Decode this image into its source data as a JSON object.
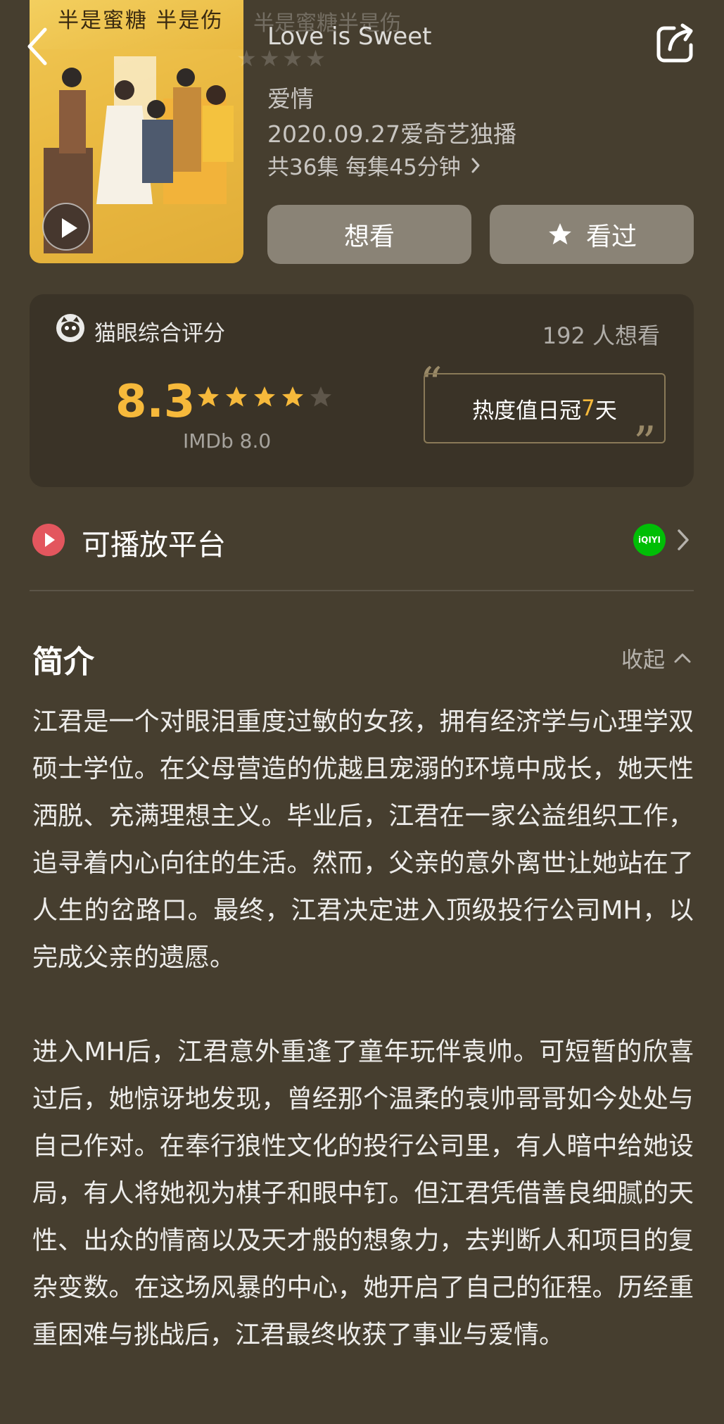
{
  "header": {
    "poster_title": "半是蜜糖 半是伤",
    "faded_title": "半是蜜糖半是伤",
    "english_title": "Love is Sweet",
    "genre": "爱情",
    "release": "2020.09.27爱奇艺独播",
    "episodes": "共36集 每集45分钟",
    "want_label": "想看",
    "seen_label": "看过"
  },
  "rating": {
    "label": "猫眼综合评分",
    "want_count": "192 人想看",
    "score": "8.3",
    "stars_filled": 4,
    "stars_total": 5,
    "imdb": "IMDb 8.0",
    "heat_prefix": "热度值日冠",
    "heat_days": "7",
    "heat_suffix": "天"
  },
  "platform": {
    "label": "可播放平台",
    "logo_text": "iQIYI"
  },
  "intro": {
    "title": "简介",
    "collapse_label": "收起",
    "text": "江君是一个对眼泪重度过敏的女孩，拥有经济学与心理学双硕士学位。在父母营造的优越且宠溺的环境中成长，她天性洒脱、充满理想主义。毕业后，江君在一家公益组织工作，追寻着内心向往的生活。然而，父亲的意外离世让她站在了人生的岔路口。最终，江君决定进入顶级投行公司MH，以完成父亲的遗愿。\n\n进入MH后，江君意外重逢了童年玩伴袁帅。可短暂的欣喜过后，她惊讶地发现，曾经那个温柔的袁帅哥哥如今处处与自己作对。在奉行狼性文化的投行公司里，有人暗中给她设局，有人将她视为棋子和眼中钉。但江君凭借善良细腻的天性、出众的情商以及天才般的想象力，去判断人和项目的复杂变数。在这场风暴的中心，她开启了自己的征程。历经重重困难与挑战后，江君最终收获了事业与爱情。"
  },
  "colors": {
    "background": "#463e2f",
    "card": "#3a3327",
    "accent": "#f6b93b",
    "button": "#8a8376"
  }
}
